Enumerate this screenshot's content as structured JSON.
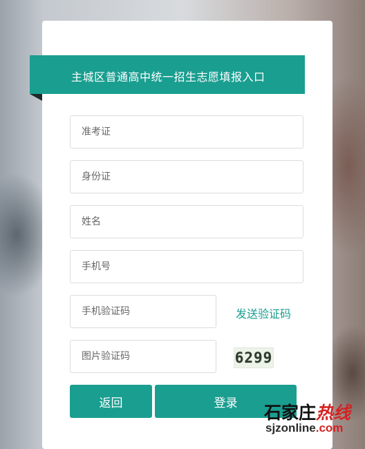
{
  "header": {
    "title": "主城区普通高中统一招生志愿填报入口"
  },
  "form": {
    "exam_id_placeholder": "准考证",
    "id_card_placeholder": "身份证",
    "name_placeholder": "姓名",
    "phone_placeholder": "手机号",
    "sms_code_placeholder": "手机验证码",
    "send_code_label": "发送验证码",
    "image_code_placeholder": "图片验证码",
    "captcha_text": "6299"
  },
  "buttons": {
    "back_label": "返回",
    "login_label": "登录"
  },
  "watermark": {
    "brand_black": "石家庄",
    "brand_red": "热线",
    "url_prefix": "sjzonline",
    "url_suffix": ".com"
  },
  "colors": {
    "accent": "#1a9e90",
    "watermark_red": "#d42222"
  }
}
